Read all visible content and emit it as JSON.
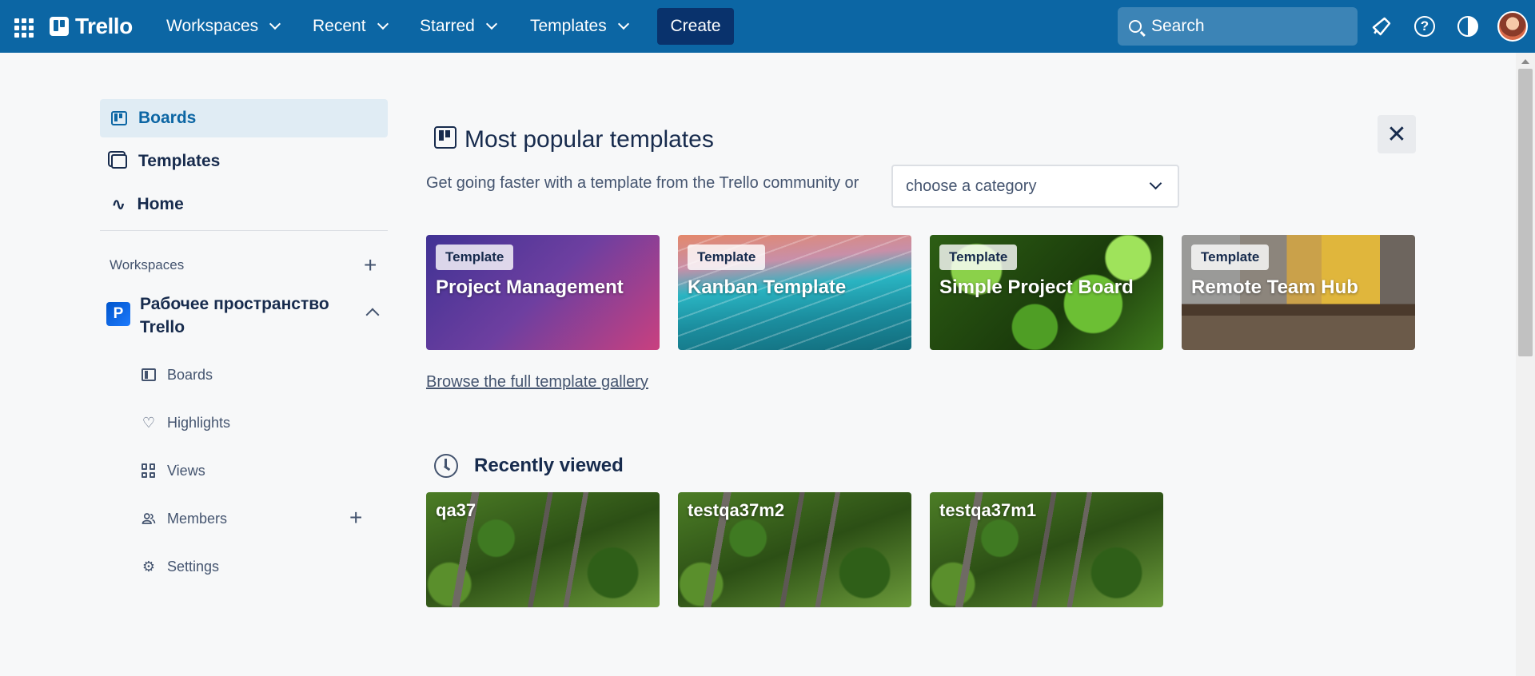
{
  "header": {
    "logo_text": "Trello",
    "nav": [
      "Workspaces",
      "Recent",
      "Starred",
      "Templates"
    ],
    "create_label": "Create",
    "search_placeholder": "Search",
    "brand_color": "#0c66a4"
  },
  "sidebar": {
    "items": [
      {
        "label": "Boards",
        "icon": "board-icon",
        "active": true
      },
      {
        "label": "Templates",
        "icon": "template-icon"
      },
      {
        "label": "Home",
        "icon": "pulse-icon"
      }
    ],
    "workspaces_label": "Workspaces",
    "workspace": {
      "badge": "P",
      "name": "Рабочее пространство Trello",
      "items": [
        {
          "label": "Boards",
          "icon": "board-icon"
        },
        {
          "label": "Highlights",
          "icon": "heart-icon"
        },
        {
          "label": "Views",
          "icon": "grid-icon"
        },
        {
          "label": "Members",
          "icon": "members-icon"
        },
        {
          "label": "Settings",
          "icon": "gear-icon"
        }
      ]
    }
  },
  "main": {
    "templates_title": "Most popular templates",
    "subtitle": "Get going faster with a template from the Trello community or",
    "category_placeholder": "choose a category",
    "template_badge": "Template",
    "templates": [
      "Project Management",
      "Kanban Template",
      "Simple Project Board",
      "Remote Team Hub"
    ],
    "browse_link": "Browse the full template gallery",
    "recent_title": "Recently viewed",
    "recent_boards": [
      "qa37",
      "testqa37m2",
      "testqa37m1"
    ]
  }
}
